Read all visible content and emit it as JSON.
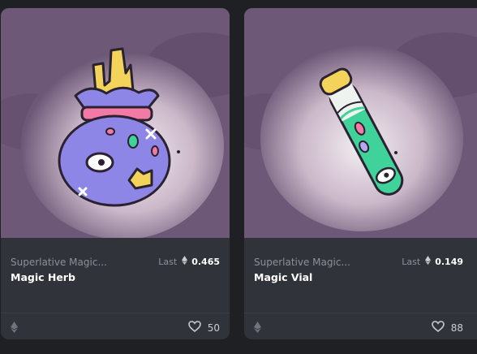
{
  "cards": [
    {
      "collection": "Superlative Magic...",
      "name": "Magic Herb",
      "price_label": "Last",
      "price_value": "0.465",
      "likes": "50",
      "currency_icon": "ethereum-icon",
      "like_icon": "heart-icon"
    },
    {
      "collection": "Superlative Magic...",
      "name": "Magic Vial",
      "price_label": "Last",
      "price_value": "0.149",
      "likes": "88",
      "currency_icon": "ethereum-icon",
      "like_icon": "heart-icon"
    }
  ],
  "colors": {
    "page_bg": "#1f2024",
    "card_bg": "#303339",
    "art_bg": "#6e5878",
    "muted_text": "#8c9098",
    "title_text": "#ffffff"
  }
}
